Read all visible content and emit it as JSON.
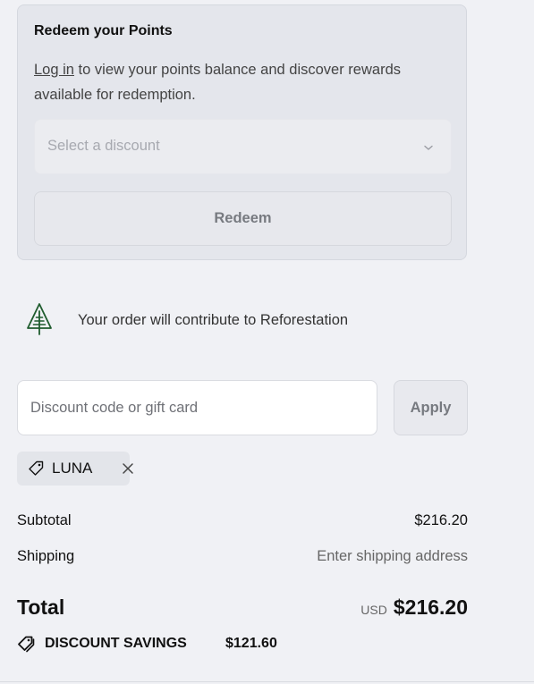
{
  "redeem_points": {
    "title": "Redeem your Points",
    "login_link": "Log in",
    "description_rest": " to view your points balance and discover rewards available for redemption.",
    "select_placeholder": "Select a discount",
    "redeem_label": "Redeem"
  },
  "reforestation": {
    "icon": "tree-icon",
    "text": "Your order will contribute to Reforestation",
    "accent_color": "#1f5c2e"
  },
  "discount": {
    "placeholder": "Discount code or gift card",
    "value": "",
    "apply_label": "Apply",
    "applied_codes": [
      {
        "code": "LUNA",
        "icon": "tag-icon"
      }
    ]
  },
  "summary": {
    "subtotal_label": "Subtotal",
    "subtotal_value": "$216.20",
    "shipping_label": "Shipping",
    "shipping_value": "Enter shipping address",
    "total_label": "Total",
    "total_currency": "USD",
    "total_value": "$216.20",
    "savings_label": "DISCOUNT SAVINGS",
    "savings_value": "$121.60"
  }
}
